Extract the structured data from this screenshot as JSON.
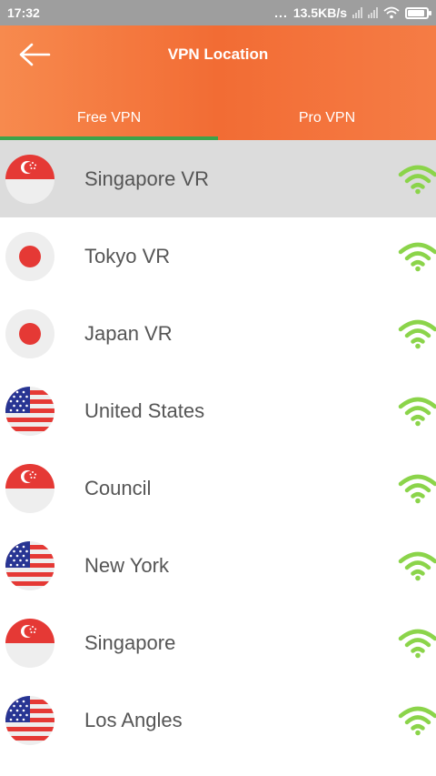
{
  "status": {
    "time": "17:32",
    "dots": "...",
    "speed": "13.5KB/s"
  },
  "header": {
    "title": "VPN Location"
  },
  "tabs": [
    {
      "label": "Free VPN"
    },
    {
      "label": "Pro VPN"
    }
  ],
  "colors": {
    "accent": "#f26c34",
    "tab_indicator": "#3da34a",
    "wifi_green": "#8bd44a"
  },
  "locations": [
    {
      "name": "Singapore VR",
      "flag": "singapore-flag-icon",
      "selected": true
    },
    {
      "name": "Tokyo VR",
      "flag": "japan-flag-icon"
    },
    {
      "name": "Japan VR",
      "flag": "japan-flag-icon"
    },
    {
      "name": "United States",
      "flag": "usa-flag-icon"
    },
    {
      "name": "Council",
      "flag": "singapore-flag-icon"
    },
    {
      "name": "New York",
      "flag": "usa-flag-icon"
    },
    {
      "name": "Singapore",
      "flag": "singapore-flag-icon"
    },
    {
      "name": "Los Angles",
      "flag": "usa-flag-icon"
    }
  ]
}
